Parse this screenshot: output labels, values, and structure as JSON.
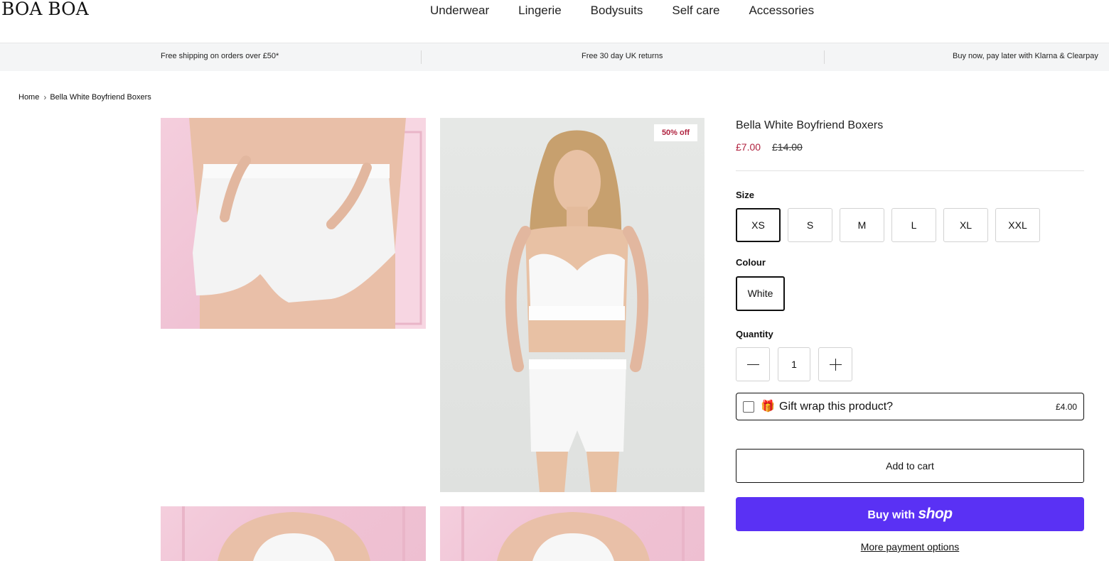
{
  "header": {
    "logo": "BOA BOA",
    "nav": [
      "Underwear",
      "Lingerie",
      "Bodysuits",
      "Self care",
      "Accessories"
    ]
  },
  "announcements": [
    "Free shipping on orders over £50*",
    "Free 30 day UK returns",
    "Buy now, pay later with Klarna & Clearpay"
  ],
  "breadcrumb": {
    "home": "Home",
    "current": "Bella White Boyfriend Boxers"
  },
  "gallery": {
    "badge": "50% off"
  },
  "product": {
    "title": "Bella White Boyfriend Boxers",
    "price_sale": "£7.00",
    "price_original": "£14.00",
    "size_label": "Size",
    "sizes": [
      "XS",
      "S",
      "M",
      "L",
      "XL",
      "XXL"
    ],
    "selected_size": "XS",
    "colour_label": "Colour",
    "colour": "White",
    "quantity_label": "Quantity",
    "quantity": "1",
    "gift_wrap": {
      "emoji": "🎁",
      "label": "Gift wrap this product?",
      "price": "£4.00"
    },
    "add_to_cart": "Add to cart",
    "buy_with": "Buy with",
    "shop_brand": "shop",
    "more_payment": "More payment options"
  },
  "colors": {
    "sale": "#b0223f",
    "shop_pay": "#5a31f4"
  }
}
